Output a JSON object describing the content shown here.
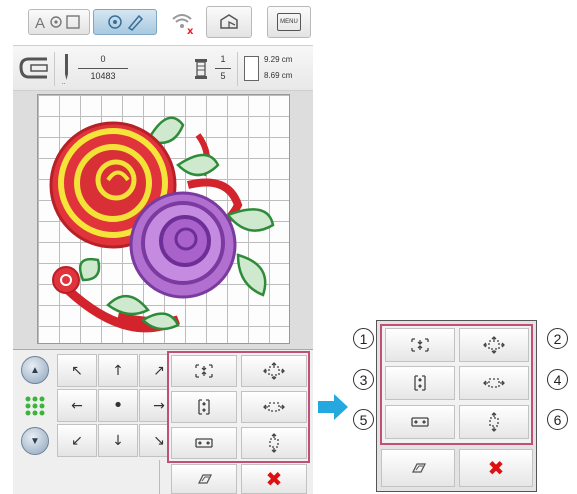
{
  "toolbar": {
    "mode_text_icon": "text-mode-icon",
    "mode_embroidery_icon": "embroidery-edit-icon",
    "wifi_status_icon": "wifi-disconnected-icon",
    "rotate_icon": "layout-icon",
    "menu_label": "MENU"
  },
  "info": {
    "stitch_current": "0",
    "stitch_total": "10483",
    "color_current": "1",
    "color_total": "5",
    "width": "9.29 cm",
    "height": "8.69 cm"
  },
  "move_panel": {
    "center_dot": "•",
    "arrows": [
      "↖",
      "↑",
      "↗",
      "←",
      "→",
      "↙",
      "↓",
      "↘"
    ]
  },
  "callout": {
    "numbers": [
      "1",
      "2",
      "3",
      "4",
      "5",
      "6"
    ]
  },
  "colors": {
    "accent_border": "#c04f7a",
    "arrow": "#25a8e0",
    "cancel": "#dd1111",
    "pattern_green": "#3ab53a"
  }
}
